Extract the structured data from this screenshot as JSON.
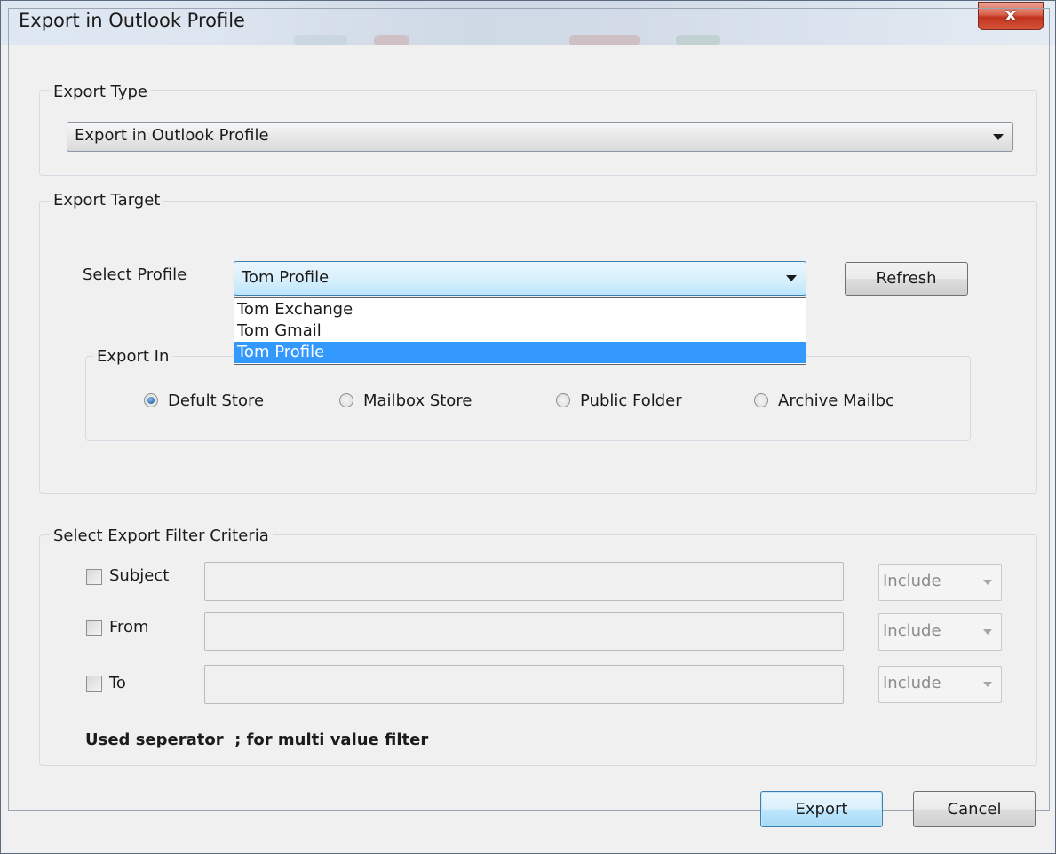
{
  "window": {
    "title": "Export in Outlook Profile",
    "close_glyph": "x"
  },
  "export_type": {
    "legend": "Export Type",
    "selected": "Export in Outlook Profile"
  },
  "export_target": {
    "legend": "Export Target",
    "select_profile_label": "Select Profile",
    "selected_profile": "Tom Profile",
    "profile_options": [
      "Tom Exchange",
      "Tom Gmail",
      "Tom Profile"
    ],
    "refresh_label": "Refresh",
    "export_in": {
      "legend": "Export In",
      "options": [
        "Defult Store",
        "Mailbox Store",
        "Public Folder",
        "Archive Mailbc"
      ],
      "checked_index": 0
    }
  },
  "filter": {
    "legend": "Select Export Filter Criteria",
    "rows": [
      {
        "label": "Subject",
        "value": "",
        "mode": "Include"
      },
      {
        "label": "From",
        "value": "",
        "mode": "Include"
      },
      {
        "label": "To",
        "value": "",
        "mode": "Include"
      }
    ],
    "note": "Used seperator  ; for multi value filter"
  },
  "actions": {
    "export_label": "Export",
    "cancel_label": "Cancel"
  }
}
